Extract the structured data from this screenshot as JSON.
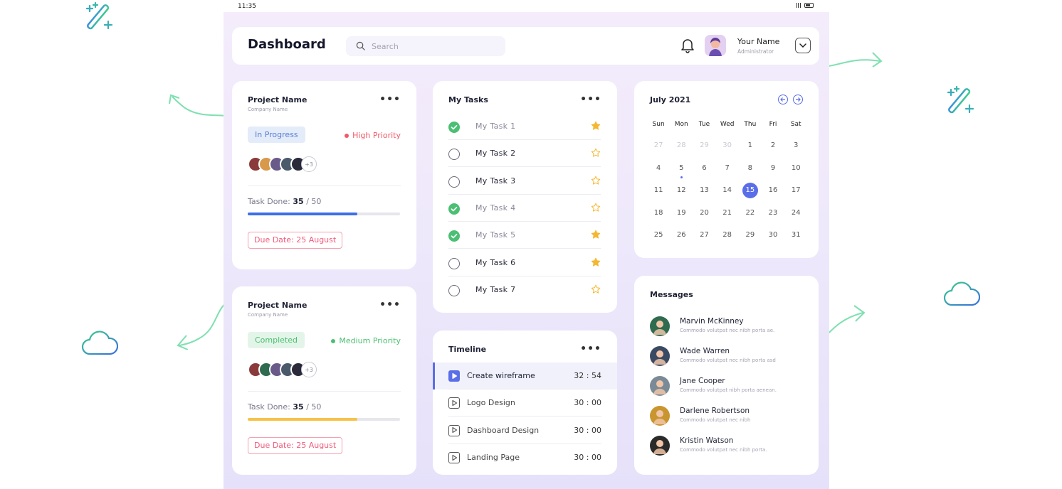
{
  "status_bar": {
    "time": "11:35"
  },
  "header": {
    "title": "Dashboard",
    "search_placeholder": "Search",
    "user_name": "Your Name",
    "user_role": "Administrator"
  },
  "projects": [
    {
      "title": "Project Name",
      "company": "Company Name",
      "status": "In Progress",
      "priority": "High Priority",
      "extra_members": "+3",
      "task_done_label": "Task Done:",
      "task_done": "35",
      "task_total": "/ 50",
      "progress": 0.72,
      "due": "Due Date: 25 August",
      "colors": {
        "status_bg": "#e4ecf9",
        "status_fg": "#5a7fd6",
        "priority": "#f05a6a",
        "bar": "#3d6fe6"
      }
    },
    {
      "title": "Project Name",
      "company": "Company Name",
      "status": "Completed",
      "priority": "Medium Priority",
      "extra_members": "+3",
      "task_done_label": "Task Done:",
      "task_done": "35",
      "task_total": "/ 50",
      "progress": 0.72,
      "due": "Due Date: 25 August",
      "colors": {
        "status_bg": "#e3f5e8",
        "status_fg": "#4bbf73",
        "priority": "#4bbf73",
        "bar": "#f7c24a"
      }
    }
  ],
  "tasks": {
    "title": "My Tasks",
    "items": [
      {
        "label": "My Task  1",
        "done": true,
        "starred": true
      },
      {
        "label": "My Task  2",
        "done": false,
        "starred": false
      },
      {
        "label": "My Task  3",
        "done": false,
        "starred": false
      },
      {
        "label": "My Task  4",
        "done": true,
        "starred": false
      },
      {
        "label": "My Task  5",
        "done": true,
        "starred": true
      },
      {
        "label": "My Task  6",
        "done": false,
        "starred": true
      },
      {
        "label": "My Task  7",
        "done": false,
        "starred": false
      }
    ]
  },
  "timeline": {
    "title": "Timeline",
    "items": [
      {
        "label": "Create wireframe",
        "time": "32 : 54",
        "active": true
      },
      {
        "label": "Logo Design",
        "time": "30 : 00",
        "active": false
      },
      {
        "label": "Dashboard Design",
        "time": "30 : 00",
        "active": false
      },
      {
        "label": "Landing Page",
        "time": "30 : 00",
        "active": false
      }
    ]
  },
  "calendar": {
    "month": "July 2021",
    "weekdays": [
      "Sun",
      "Mon",
      "Tue",
      "Wed",
      "Thu",
      "Fri",
      "Sat"
    ],
    "days": [
      "27",
      "28",
      "29",
      "30",
      "1",
      "2",
      "3",
      "4",
      "5",
      "6",
      "7",
      "8",
      "9",
      "10",
      "11",
      "12",
      "13",
      "14",
      "15",
      "16",
      "17",
      "18",
      "19",
      "20",
      "21",
      "22",
      "23",
      "24",
      "25",
      "26",
      "27",
      "28",
      "29",
      "30",
      "31"
    ],
    "muted_count": 4,
    "selected": "15",
    "marked": "5"
  },
  "messages": {
    "title": "Messages",
    "items": [
      {
        "name": "Marvin McKinney",
        "text": "Commodo volutpat nec nibh porta ae.",
        "color": "#2f6b4f"
      },
      {
        "name": "Wade Warren",
        "text": "Commodo volutpat nec nibh porta  asd",
        "color": "#3b4a63"
      },
      {
        "name": "Jane Cooper",
        "text": "Commodo volutpat  nibh porta aenean.",
        "color": "#7a8a96"
      },
      {
        "name": "Darlene Robertson",
        "text": "Commodo volutpat nec nibh",
        "color": "#c9952f"
      },
      {
        "name": "Kristin Watson",
        "text": "Commodo volutpat nec nibh porta.",
        "color": "#2a2a2a"
      }
    ]
  },
  "theme": {
    "accent": "#5a6ee8",
    "star": "#f5b731",
    "done": "#4bbf73"
  }
}
